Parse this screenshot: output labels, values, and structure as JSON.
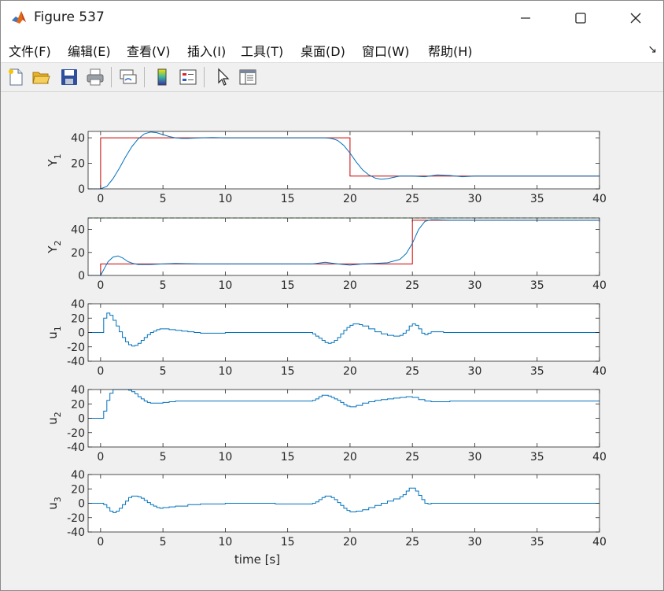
{
  "window": {
    "title": "Figure 537",
    "icon": "matlab-icon",
    "controls": [
      "minimize-icon",
      "maximize-icon",
      "close-icon"
    ]
  },
  "menu": [
    {
      "id": "file",
      "label": "文件(F)"
    },
    {
      "id": "edit",
      "label": "编辑(E)"
    },
    {
      "id": "view",
      "label": "查看(V)"
    },
    {
      "id": "insert",
      "label": "插入(I)"
    },
    {
      "id": "tools",
      "label": "工具(T)"
    },
    {
      "id": "desktop",
      "label": "桌面(D)"
    },
    {
      "id": "window",
      "label": "窗口(W)"
    },
    {
      "id": "help",
      "label": "帮助(H)"
    }
  ],
  "menu_overflow_icon": "dock-arrow-icon",
  "toolbar": [
    "new-figure-icon",
    "open-file-icon",
    "save-icon",
    "print-icon",
    "link-plot-icon",
    "colorbar-icon",
    "legend-icon",
    "edit-plot-pointer-icon",
    "property-inspector-icon"
  ],
  "colors": {
    "reference": "#cc0000",
    "response": "#0072bd",
    "limit": "#008000"
  },
  "chart_data": [
    {
      "type": "line",
      "ylabel": "Y",
      "ylabel_sub": "1",
      "xlim": [
        -1,
        40
      ],
      "ylim": [
        0,
        45
      ],
      "xticks": [
        0,
        5,
        10,
        15,
        20,
        25,
        30,
        35,
        40
      ],
      "yticks": [
        0,
        20,
        40
      ],
      "series": [
        {
          "role": "reference",
          "color": "#cc0000",
          "x": [
            -1,
            0,
            0,
            20,
            20,
            40
          ],
          "y": [
            0,
            0,
            40,
            40,
            10,
            10
          ]
        },
        {
          "role": "response",
          "color": "#0072bd",
          "x": [
            -1,
            0,
            0.5,
            1,
            1.5,
            2,
            2.5,
            3,
            3.5,
            4,
            4.5,
            5,
            5.5,
            6,
            6.5,
            7,
            8,
            9,
            10,
            12,
            14,
            16,
            17,
            18,
            18.5,
            19,
            19.5,
            20,
            20.5,
            21,
            21.5,
            22,
            22.5,
            23,
            23.5,
            24,
            25,
            26,
            27,
            28,
            29,
            30,
            32,
            35,
            40
          ],
          "y": [
            0,
            0,
            2,
            8,
            16,
            25,
            33,
            39,
            43,
            44.5,
            44,
            42.5,
            41,
            40,
            39.5,
            39.5,
            40,
            40.2,
            40,
            40,
            40,
            40,
            40,
            40,
            39.5,
            38,
            34,
            28,
            21,
            15,
            11,
            8.5,
            7.5,
            8,
            9,
            10,
            10,
            9.5,
            11,
            10.5,
            9.5,
            10,
            10,
            10,
            10
          ]
        }
      ]
    },
    {
      "type": "line",
      "ylabel": "Y",
      "ylabel_sub": "2",
      "xlim": [
        -1,
        40
      ],
      "ylim": [
        0,
        50
      ],
      "xticks": [
        0,
        5,
        10,
        15,
        20,
        25,
        30,
        35,
        40
      ],
      "yticks": [
        0,
        20,
        40
      ],
      "series": [
        {
          "role": "limit",
          "style": "dashed",
          "color": "#008000",
          "x": [
            -1,
            40
          ],
          "y": [
            50,
            50
          ]
        },
        {
          "role": "reference",
          "color": "#cc0000",
          "x": [
            -1,
            0,
            0,
            25,
            25,
            40
          ],
          "y": [
            0,
            0,
            10,
            10,
            48,
            48
          ]
        },
        {
          "role": "response",
          "color": "#0072bd",
          "x": [
            -1,
            0,
            0.3,
            0.6,
            1,
            1.4,
            1.8,
            2.2,
            2.6,
            3,
            4,
            5,
            6,
            8,
            10,
            12,
            14,
            16,
            17,
            18,
            19,
            20,
            21,
            22,
            23,
            24,
            24.5,
            25,
            25.5,
            26,
            26.5,
            27,
            28,
            30,
            35,
            40
          ],
          "y": [
            0,
            0,
            6,
            12,
            16,
            17,
            15,
            12,
            10.5,
            9.5,
            9.5,
            10,
            10.5,
            10,
            10,
            10,
            10,
            10,
            10,
            11.5,
            10,
            9,
            10,
            10.5,
            11,
            14,
            19,
            28,
            40,
            47,
            48.5,
            48.5,
            48,
            48,
            48,
            48
          ]
        }
      ]
    },
    {
      "type": "line",
      "ylabel": "u",
      "ylabel_sub": "1",
      "xlim": [
        -1,
        40
      ],
      "ylim": [
        -40,
        40
      ],
      "xticks": [
        0,
        5,
        10,
        15,
        20,
        25,
        30,
        35,
        40
      ],
      "yticks": [
        -40,
        -20,
        0,
        20,
        40
      ],
      "series": [
        {
          "role": "response",
          "color": "#0072bd",
          "stairs": true,
          "x": [
            -1,
            0,
            0.25,
            0.5,
            0.75,
            1,
            1.25,
            1.5,
            1.75,
            2,
            2.25,
            2.5,
            2.75,
            3,
            3.25,
            3.5,
            3.75,
            4,
            4.25,
            4.5,
            4.75,
            5,
            5.5,
            6,
            6.5,
            7,
            7.5,
            8,
            9,
            10,
            11,
            12,
            13,
            14,
            15,
            16,
            16.5,
            17,
            17.25,
            17.5,
            17.75,
            18,
            18.25,
            18.5,
            18.75,
            19,
            19.25,
            19.5,
            19.75,
            20,
            20.25,
            20.5,
            20.75,
            21,
            21.5,
            22,
            22.5,
            23,
            23.5,
            24,
            24.25,
            24.5,
            24.75,
            25,
            25.25,
            25.5,
            25.75,
            26,
            26.25,
            26.5,
            27,
            27.5,
            28,
            30,
            35,
            40
          ],
          "y": [
            0,
            0,
            20,
            27,
            24,
            17,
            9,
            1,
            -7,
            -13,
            -17,
            -19,
            -18,
            -15,
            -11,
            -7,
            -3,
            0,
            2,
            4,
            5,
            5,
            4,
            3,
            2,
            1,
            0,
            -1,
            -1,
            0,
            0,
            0,
            0,
            0,
            0,
            0,
            0,
            -2,
            -5,
            -8,
            -11,
            -14,
            -15,
            -14,
            -11,
            -7,
            -2,
            3,
            7,
            10,
            12,
            12,
            11,
            9,
            5,
            1,
            -2,
            -4,
            -5,
            -4,
            -1,
            3,
            9,
            12,
            10,
            5,
            -1,
            -3,
            -1,
            1,
            1,
            0,
            0,
            0,
            0,
            0
          ]
        }
      ]
    },
    {
      "type": "line",
      "ylabel": "u",
      "ylabel_sub": "2",
      "xlim": [
        -1,
        40
      ],
      "ylim": [
        -40,
        40
      ],
      "xticks": [
        0,
        5,
        10,
        15,
        20,
        25,
        30,
        35,
        40
      ],
      "yticks": [
        -40,
        -20,
        0,
        20,
        40
      ],
      "series": [
        {
          "role": "response",
          "color": "#0072bd",
          "stairs": true,
          "x": [
            -1,
            0,
            0.25,
            0.5,
            0.75,
            1,
            1.5,
            2,
            2.25,
            2.5,
            2.75,
            3,
            3.25,
            3.5,
            3.75,
            4,
            4.5,
            5,
            5.5,
            6,
            7,
            8,
            10,
            12,
            14,
            16,
            17,
            17.25,
            17.5,
            17.75,
            18,
            18.25,
            18.5,
            18.75,
            19,
            19.25,
            19.5,
            19.75,
            20,
            20.5,
            21,
            21.5,
            22,
            22.5,
            23,
            23.5,
            24,
            24.5,
            25,
            25.5,
            26,
            26.5,
            27,
            28,
            30,
            35,
            40
          ],
          "y": [
            0,
            0,
            10,
            25,
            35,
            40,
            40,
            40,
            39,
            37,
            34,
            30,
            27,
            24,
            22,
            21,
            21,
            22,
            23,
            24,
            24,
            24,
            24,
            24,
            24,
            24,
            25,
            27,
            30,
            32,
            32,
            31,
            29,
            27,
            25,
            22,
            19,
            17,
            16,
            18,
            21,
            23,
            25,
            26,
            27,
            28,
            29,
            30,
            29,
            26,
            24,
            23,
            23,
            24,
            24,
            24,
            24
          ]
        }
      ]
    },
    {
      "type": "line",
      "ylabel": "u",
      "ylabel_sub": "3",
      "xlim": [
        -1,
        40
      ],
      "ylim": [
        -40,
        40
      ],
      "xticks": [
        0,
        5,
        10,
        15,
        20,
        25,
        30,
        35,
        40
      ],
      "yticks": [
        -40,
        -20,
        0,
        20,
        40
      ],
      "xlabel": "time [s]",
      "series": [
        {
          "role": "response",
          "color": "#0072bd",
          "stairs": true,
          "x": [
            -1,
            0,
            0.25,
            0.5,
            0.75,
            1,
            1.25,
            1.5,
            1.75,
            2,
            2.25,
            2.5,
            2.75,
            3,
            3.25,
            3.5,
            3.75,
            4,
            4.25,
            4.5,
            4.75,
            5,
            5.5,
            6,
            7,
            8,
            10,
            12,
            14,
            16,
            17,
            17.25,
            17.5,
            17.75,
            18,
            18.25,
            18.5,
            18.75,
            19,
            19.25,
            19.5,
            19.75,
            20,
            20.5,
            21,
            21.5,
            22,
            22.5,
            23,
            23.5,
            24,
            24.25,
            24.5,
            24.75,
            25,
            25.25,
            25.5,
            25.75,
            26,
            26.25,
            26.5,
            27,
            28,
            30,
            35,
            40
          ],
          "y": [
            0,
            0,
            -2,
            -6,
            -11,
            -13,
            -11,
            -7,
            -2,
            3,
            8,
            10,
            10,
            9,
            7,
            4,
            1,
            -2,
            -4,
            -6,
            -7,
            -6,
            -5,
            -4,
            -2,
            -1,
            0,
            0,
            -1,
            -1,
            0,
            2,
            5,
            8,
            10,
            10,
            8,
            5,
            1,
            -3,
            -7,
            -10,
            -12,
            -11,
            -9,
            -6,
            -3,
            0,
            3,
            6,
            9,
            12,
            17,
            21,
            21,
            17,
            11,
            5,
            0,
            -1,
            0,
            0,
            0,
            0,
            0,
            0
          ]
        }
      ]
    }
  ]
}
